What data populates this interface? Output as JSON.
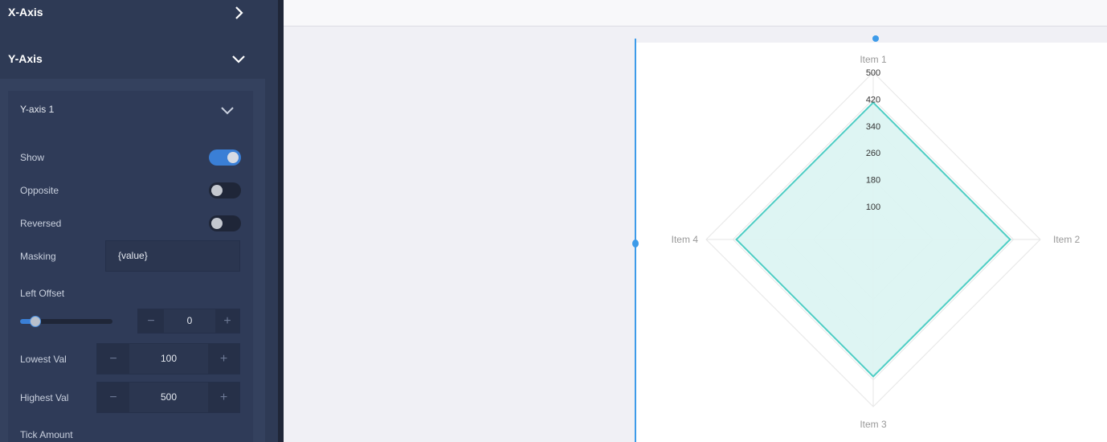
{
  "sidebar": {
    "xaxis": {
      "title": "X-Axis",
      "icon": "chevron-right-icon"
    },
    "yaxis": {
      "title": "Y-Axis",
      "icon": "chevron-down-icon"
    },
    "yaxis1": {
      "title": "Y-axis 1",
      "show_label": "Show",
      "show_on": true,
      "opposite_label": "Opposite",
      "opposite_on": false,
      "reversed_label": "Reversed",
      "reversed_on": false,
      "masking_label": "Masking",
      "masking_value": "{value}",
      "left_offset_label": "Left Offset",
      "left_offset_value": "0",
      "left_offset_fraction": 0.1,
      "lowest_label": "Lowest Val",
      "lowest_value": "100",
      "highest_label": "Highest Val",
      "highest_value": "500",
      "tick_label": "Tick Amount",
      "minus": "−",
      "plus": "+"
    }
  },
  "colors": {
    "accent": "#3a7fd6",
    "series": "#4ecdc4",
    "series_fill": "#dcf4f2"
  },
  "chart_data": {
    "type": "radar",
    "categories": [
      "Item 1",
      "Item 2",
      "Item 3",
      "Item 4"
    ],
    "series": [
      {
        "values": [
          410,
          410,
          410,
          410
        ]
      }
    ],
    "ylim": [
      100,
      500
    ],
    "ticks": [
      "100",
      "180",
      "260",
      "340",
      "420",
      "500"
    ],
    "grid": true
  }
}
